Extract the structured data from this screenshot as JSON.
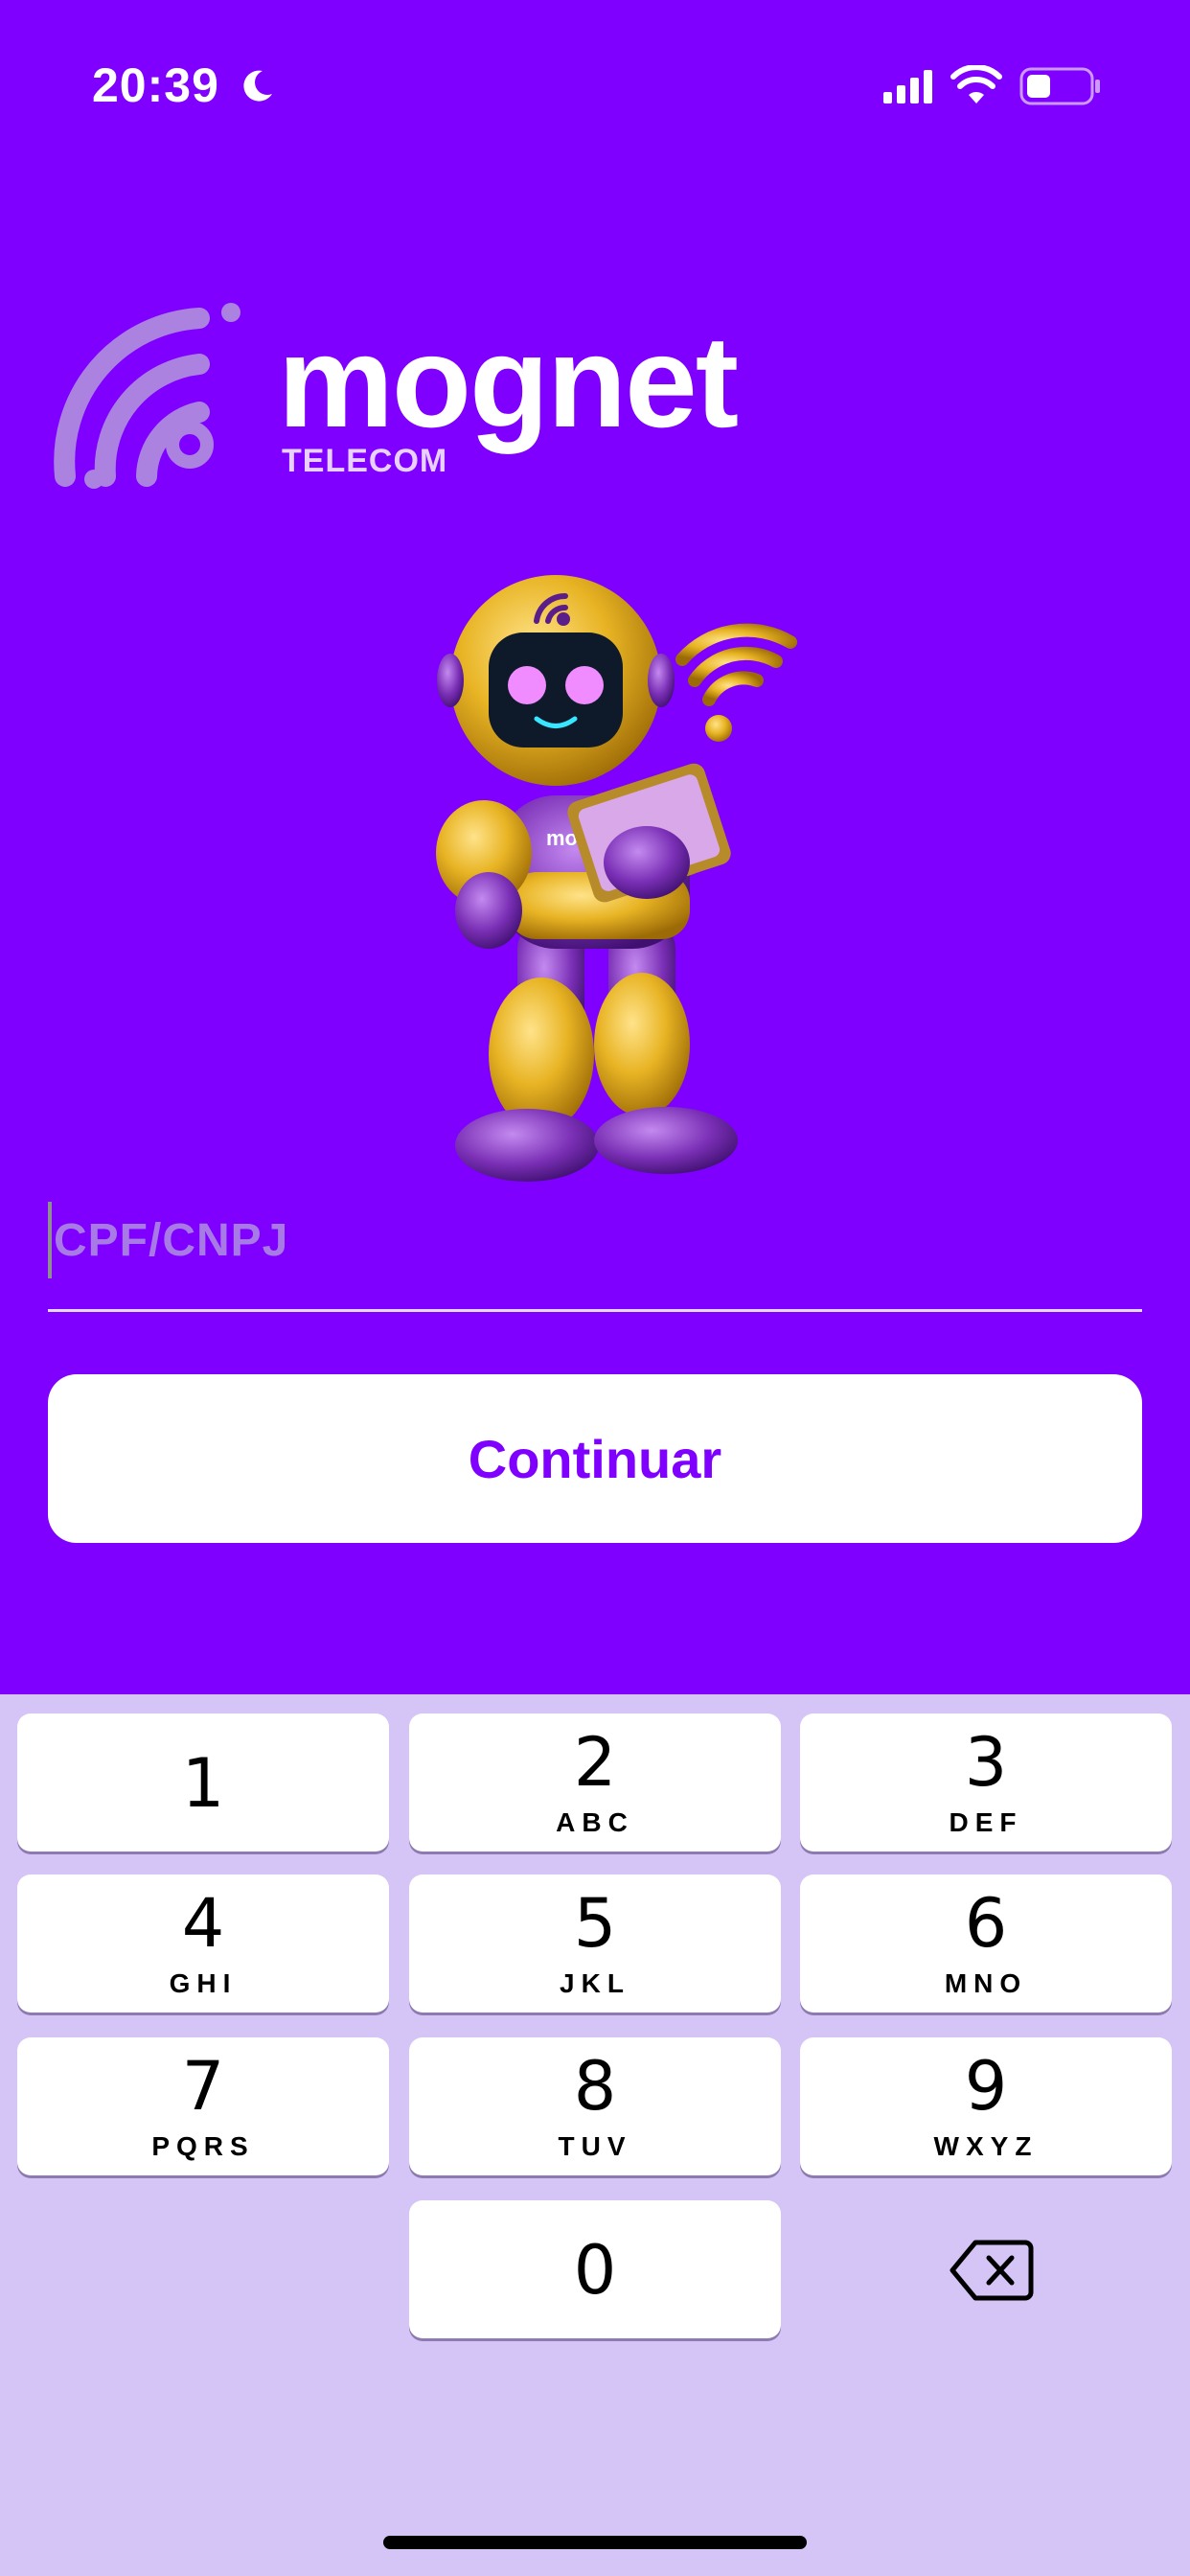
{
  "status_bar": {
    "time": "20:39",
    "icons": [
      "moon-icon",
      "cellular-signal-icon",
      "wifi-icon",
      "battery-icon"
    ]
  },
  "logo": {
    "word": "mognet",
    "subtitle": "TELECOM"
  },
  "login": {
    "input_placeholder": "CPF/CNPJ",
    "input_value": "",
    "continue_label": "Continuar"
  },
  "keyboard": {
    "keys": [
      {
        "digit": "1",
        "letters": ""
      },
      {
        "digit": "2",
        "letters": "ABC"
      },
      {
        "digit": "3",
        "letters": "DEF"
      },
      {
        "digit": "4",
        "letters": "GHI"
      },
      {
        "digit": "5",
        "letters": "JKL"
      },
      {
        "digit": "6",
        "letters": "MNO"
      },
      {
        "digit": "7",
        "letters": "PQRS"
      },
      {
        "digit": "8",
        "letters": "TUV"
      },
      {
        "digit": "9",
        "letters": "WXYZ"
      },
      {
        "digit": "0",
        "letters": ""
      }
    ],
    "delete_icon": "backspace-icon"
  },
  "colors": {
    "brand": "#7f00ff",
    "keyboard_bg": "#d5c5f6",
    "mascot_gold": "#e8b424",
    "mascot_purple": "#7a2fb5"
  }
}
